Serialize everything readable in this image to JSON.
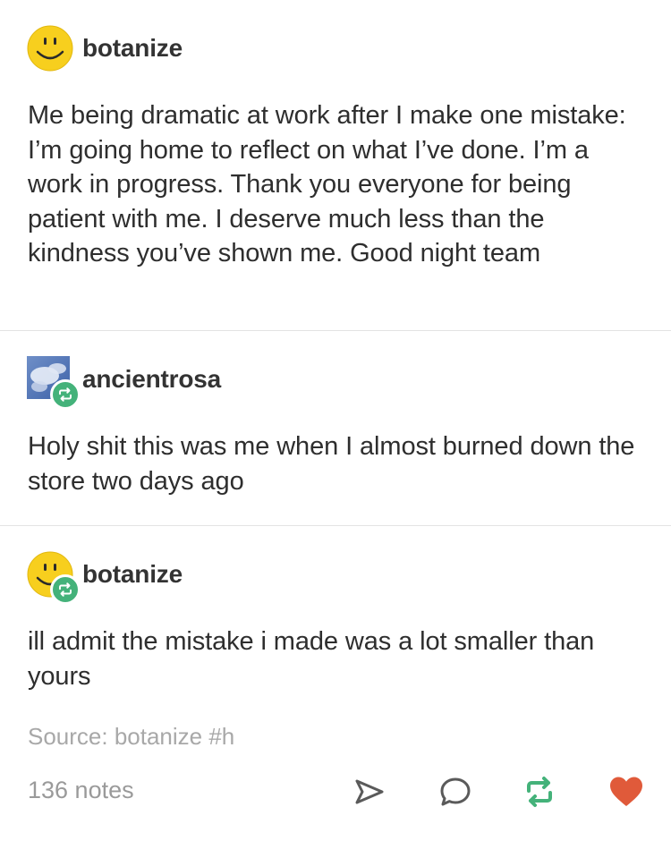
{
  "posts": [
    {
      "username": "botanize",
      "avatar": "smiley-face-avatar",
      "reblogged": false,
      "text": "Me being dramatic at work after I make one mistake: I’m going home to reflect on what I’ve done. I’m a work in progress. Thank you everyone for being patient with me. I deserve much less than the kindness you’ve shown me. Good night team"
    },
    {
      "username": "ancientrosa",
      "avatar": "cloud-sky-avatar",
      "reblogged": true,
      "text": "Holy shit this was me when I almost burned down the store two days ago"
    },
    {
      "username": "botanize",
      "avatar": "smiley-face-avatar",
      "reblogged": true,
      "text": "ill admit the mistake i made was a lot smaller than yours"
    }
  ],
  "source": "Source: botanize #h",
  "footer": {
    "notes": "136 notes",
    "actions": [
      "share-icon",
      "reply-icon",
      "reblog-icon",
      "like-heart-icon"
    ],
    "like_color": "#e05a3a",
    "reblog_color": "#44b27a"
  }
}
